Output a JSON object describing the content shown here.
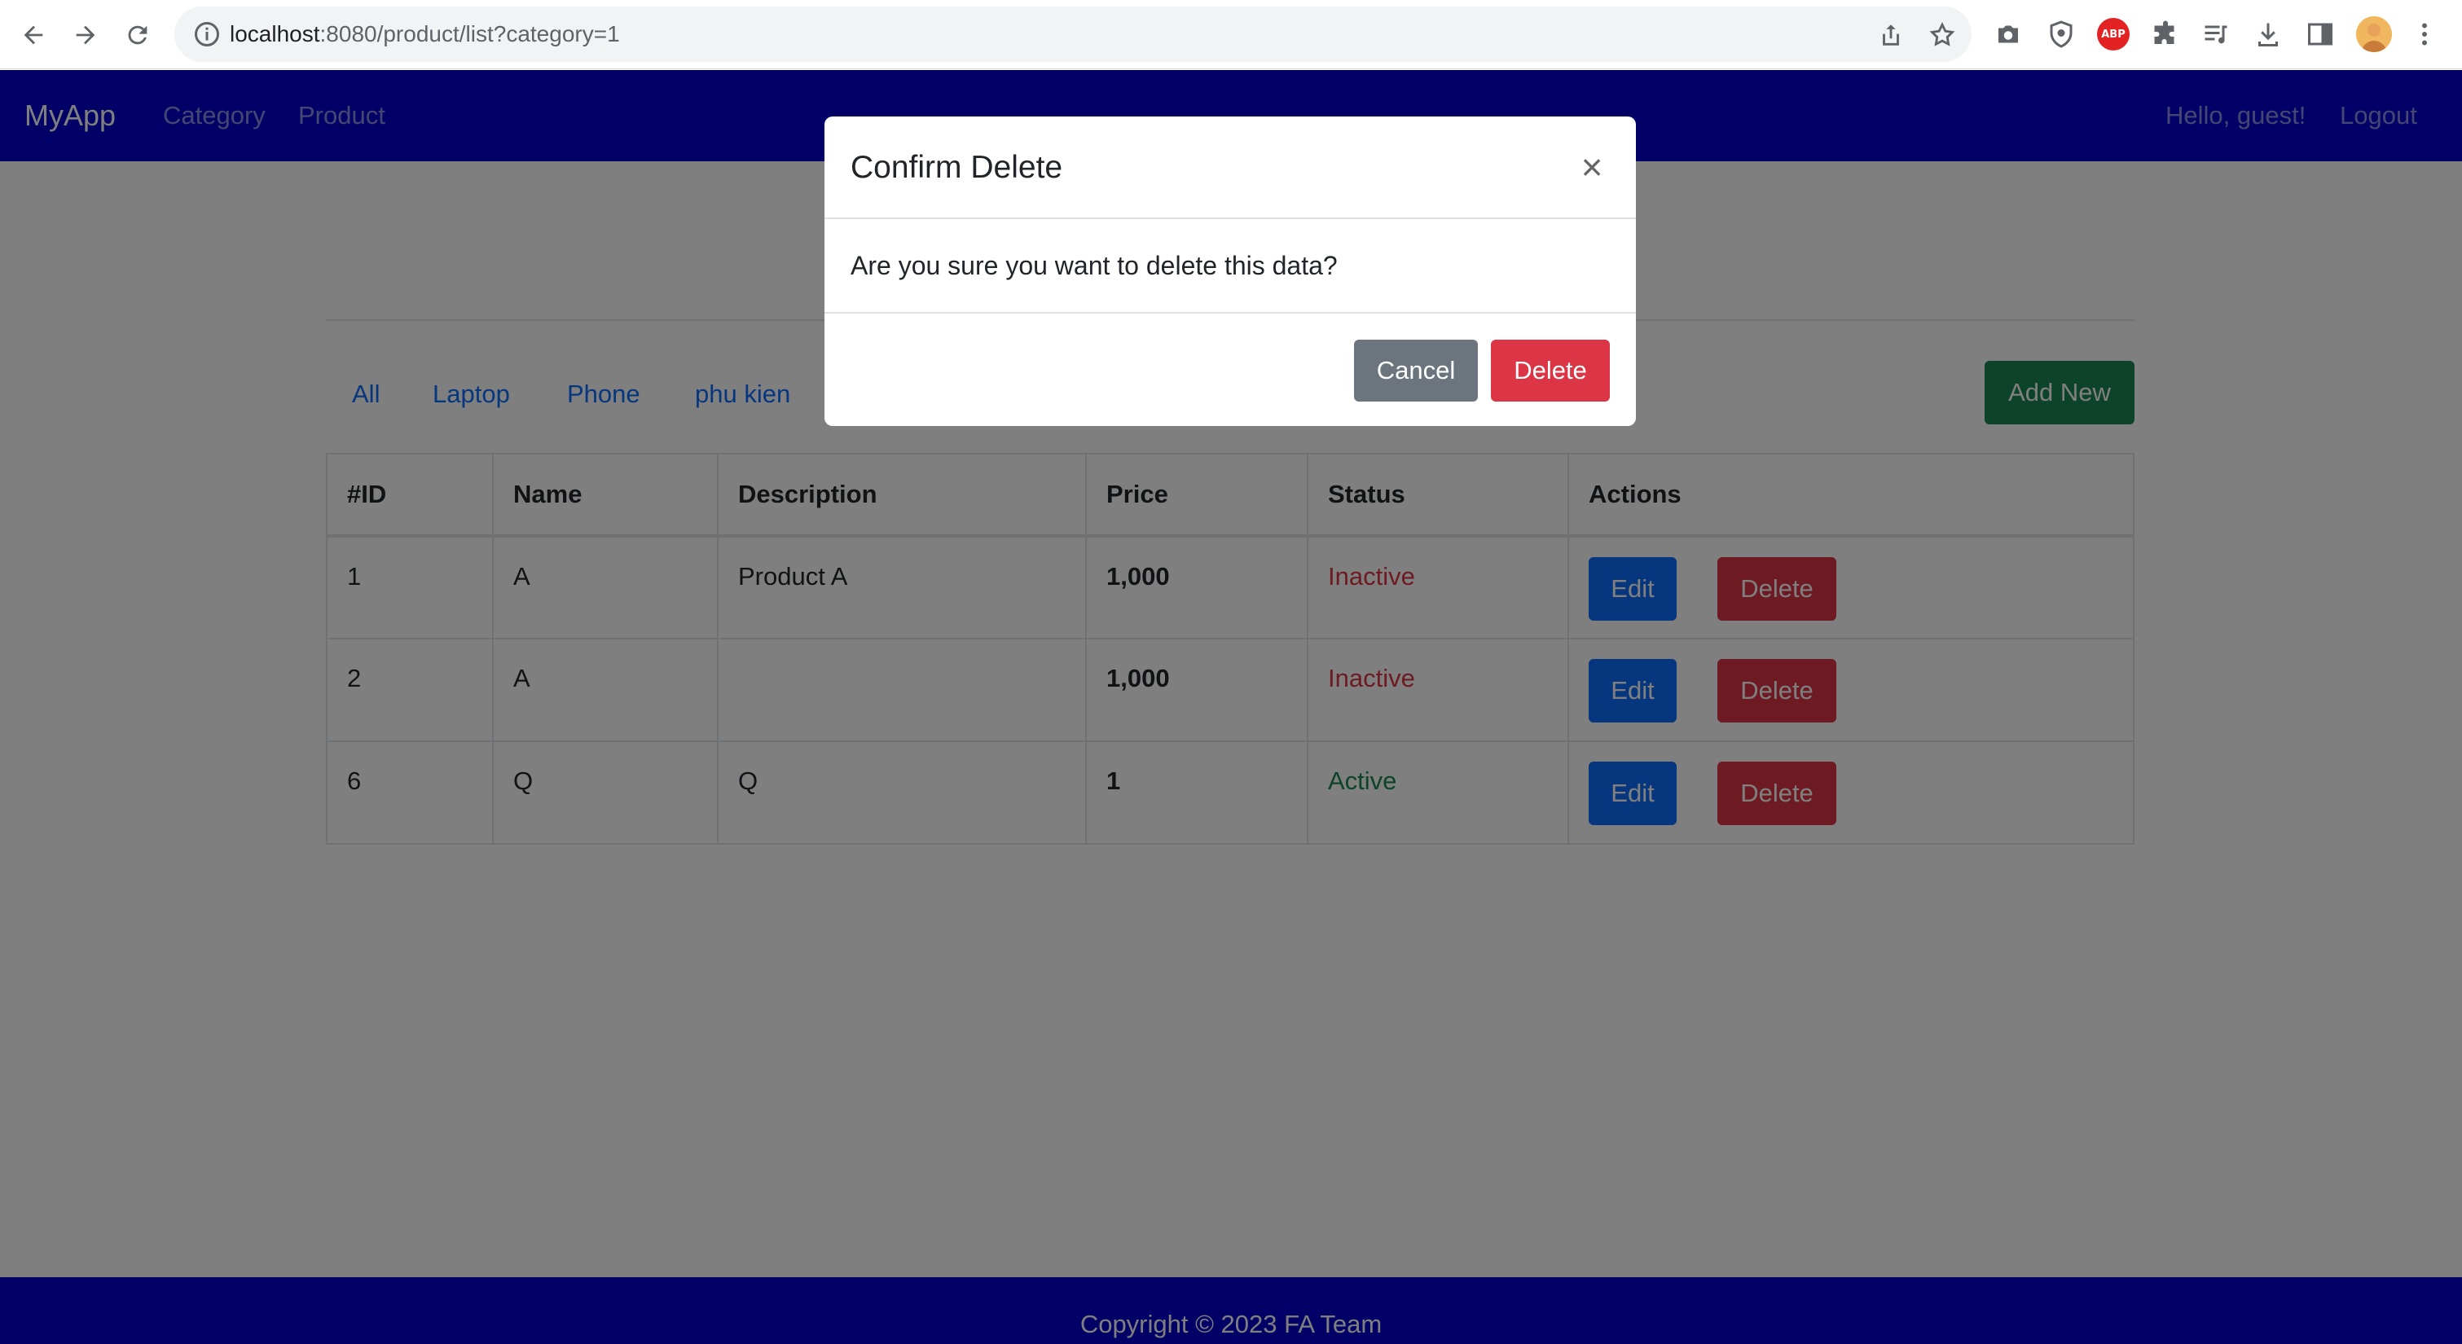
{
  "browser": {
    "url_host": "localhost",
    "url_path": ":8080/product/list?category=1",
    "extensions": [
      "camera-icon",
      "shield-icon",
      "abp-icon",
      "puzzle-icon",
      "media-icon",
      "download-icon",
      "sidepanel-icon"
    ],
    "abp_label": "ABP"
  },
  "navbar": {
    "brand": "MyApp",
    "links": [
      "Category",
      "Product"
    ],
    "greeting": "Hello, guest!",
    "logout": "Logout",
    "background": "#0000cc"
  },
  "categories": [
    "All",
    "Laptop",
    "Phone",
    "phu kien"
  ],
  "add_new_label": "Add New",
  "table": {
    "headers": [
      "#ID",
      "Name",
      "Description",
      "Price",
      "Status",
      "Actions"
    ],
    "rows": [
      {
        "id": "1",
        "name": "A",
        "description": "Product A",
        "price": "1,000",
        "status": "Inactive"
      },
      {
        "id": "2",
        "name": "A",
        "description": "",
        "price": "1,000",
        "status": "Inactive"
      },
      {
        "id": "6",
        "name": "Q",
        "description": "Q",
        "price": "1",
        "status": "Active"
      }
    ],
    "edit_label": "Edit",
    "delete_label": "Delete"
  },
  "footer": {
    "text": "Copyright © 2023 FA Team"
  },
  "modal": {
    "title": "Confirm Delete",
    "close_symbol": "×",
    "message": "Are you sure you want to delete this data?",
    "cancel_label": "Cancel",
    "delete_label": "Delete"
  },
  "colors": {
    "primary": "#0d6efd",
    "danger": "#dc3545",
    "success": "#198754",
    "secondary": "#6c757d"
  }
}
